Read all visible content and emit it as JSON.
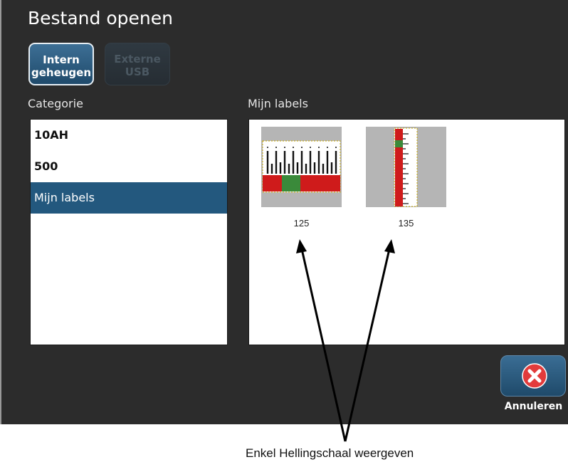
{
  "dialog": {
    "title": "Bestand openen",
    "source_buttons": [
      {
        "line1": "Intern",
        "line2": "geheugen",
        "active": true
      },
      {
        "line1": "Externe",
        "line2": "USB",
        "active": false
      }
    ],
    "category_header": "Categorie",
    "categories": [
      {
        "label": "10AH",
        "selected": false
      },
      {
        "label": "500",
        "selected": false
      },
      {
        "label": "Mijn labels",
        "selected": true
      }
    ],
    "labels_header": "Mijn labels",
    "labels": [
      {
        "name": "125"
      },
      {
        "name": "135"
      }
    ],
    "cancel_label": "Annuleren",
    "cancel_icon": "close-icon"
  },
  "annotation": {
    "caption": "Enkel Hellingschaal weergeven"
  },
  "colors": {
    "dialog_bg": "#2c2c2c",
    "selection": "#23587e",
    "accent_red": "#cf1b1b",
    "accent_green": "#3a8a3a"
  }
}
